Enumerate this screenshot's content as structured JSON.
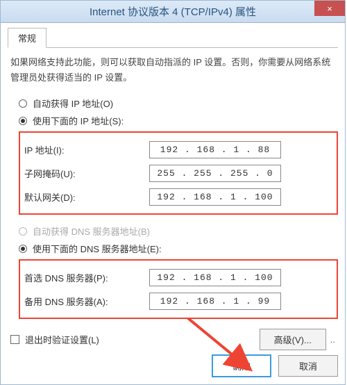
{
  "titlebar": {
    "title": "Internet 协议版本 4 (TCP/IPv4) 属性",
    "close": "×"
  },
  "tab": {
    "general": "常规"
  },
  "description": "如果网络支持此功能，则可以获取自动指派的 IP 设置。否则，你需要从网络系统管理员处获得适当的 IP 设置。",
  "ip_section": {
    "auto_label": "自动获得 IP 地址(O)",
    "manual_label": "使用下面的 IP 地址(S):",
    "ip_label": "IP 地址(I):",
    "ip_value": "192 . 168 .  1  .  88",
    "mask_label": "子网掩码(U):",
    "mask_value": "255 . 255 . 255 .  0",
    "gateway_label": "默认网关(D):",
    "gateway_value": "192 . 168 .  1  . 100"
  },
  "dns_section": {
    "auto_label": "自动获得 DNS 服务器地址(B)",
    "manual_label": "使用下面的 DNS 服务器地址(E):",
    "pref_label": "首选 DNS 服务器(P):",
    "pref_value": "192 . 168 .  1  . 100",
    "alt_label": "备用 DNS 服务器(A):",
    "alt_value": "192 . 168 .  1  .  99"
  },
  "validate_label": "退出时验证设置(L)",
  "buttons": {
    "advanced": "高级(V)...",
    "ok": "确定",
    "cancel": "取消"
  }
}
